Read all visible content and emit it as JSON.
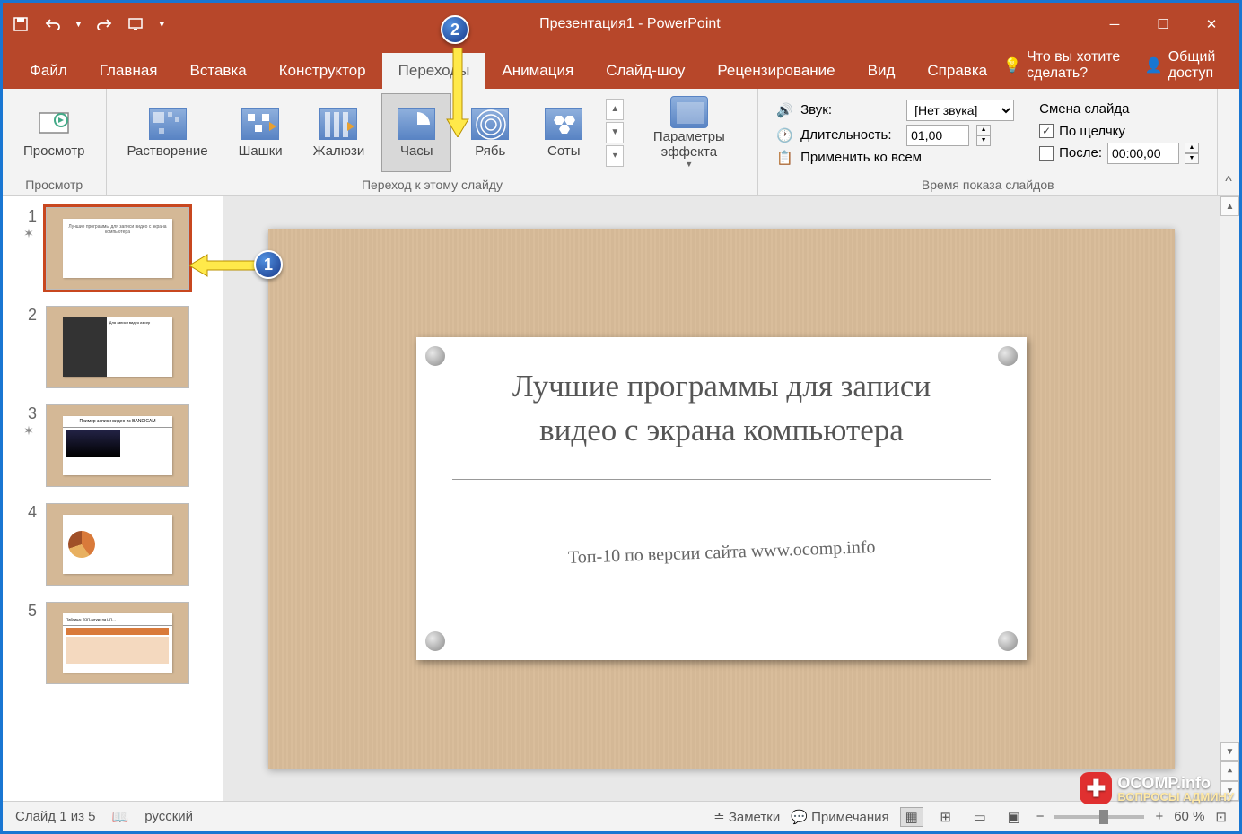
{
  "app": {
    "title": "Презентация1  -  PowerPoint"
  },
  "tabs": {
    "file": "Файл",
    "home": "Главная",
    "insert": "Вставка",
    "design": "Конструктор",
    "transitions": "Переходы",
    "animations": "Анимация",
    "slideshow": "Слайд-шоу",
    "review": "Рецензирование",
    "view": "Вид",
    "help": "Справка"
  },
  "search": {
    "placeholder": "Что вы хотите сделать?"
  },
  "share": {
    "label": "Общий доступ"
  },
  "ribbon": {
    "preview": {
      "label": "Просмотр",
      "group": "Просмотр"
    },
    "transitions": {
      "items": [
        "Растворение",
        "Шашки",
        "Жалюзи",
        "Часы",
        "Рябь",
        "Соты"
      ],
      "selected": "Часы",
      "group": "Переход к этому слайду"
    },
    "effect_options": "Параметры эффекта",
    "timing": {
      "sound_label": "Звук:",
      "sound_value": "[Нет звука]",
      "duration_label": "Длительность:",
      "duration_value": "01,00",
      "apply_all": "Применить ко всем",
      "advance_header": "Смена слайда",
      "on_click": "По щелчку",
      "after_label": "После:",
      "after_value": "00:00,00",
      "group": "Время показа слайдов"
    }
  },
  "thumbs": {
    "count": 5,
    "slide1": "Лучшие программы для записи видео с экрана компьютера",
    "slide2": "Для записи видео из игр",
    "slide3": "Пример записи видео из BANDICAM",
    "slide5": "Таблица: ТОП-штуки на ЦП…"
  },
  "slide": {
    "title": "Лучшие программы для записи видео с экрана компьютера",
    "subtitle": "Топ-10 по версии сайта www.ocomp.info"
  },
  "status": {
    "slide_indicator": "Слайд 1 из 5",
    "language": "русский",
    "notes": "Заметки",
    "comments": "Примечания",
    "zoom": "60 %"
  },
  "markers": {
    "m1": "1",
    "m2": "2"
  },
  "watermark": {
    "brand": "OCOMP.info",
    "tagline": "ВОПРОСЫ АДМИНУ"
  }
}
